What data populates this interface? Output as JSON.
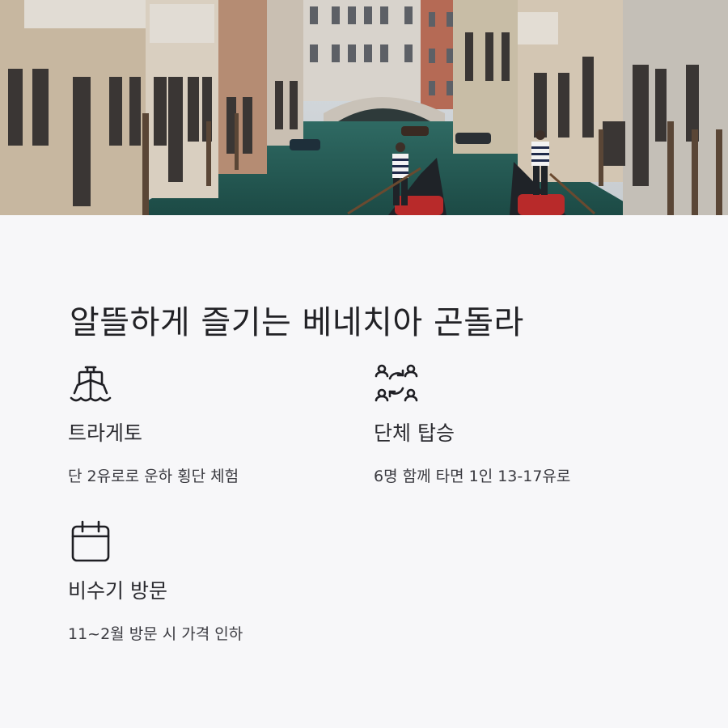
{
  "hero": {
    "image": "venice-canal-gondola-photo"
  },
  "title": "알뜰하게 즐기는 베네치아 곤돌라",
  "features": [
    {
      "icon": "ship-icon",
      "title": "트라게토",
      "description": "단 2유로로 운하 횡단 체험"
    },
    {
      "icon": "group-cycle-icon",
      "title": "단체 탑승",
      "description": "6명 함께 타면 1인 13-17유로"
    },
    {
      "icon": "calendar-icon",
      "title": "비수기 방문",
      "description": "11~2월 방문 시 가격 인하"
    }
  ]
}
